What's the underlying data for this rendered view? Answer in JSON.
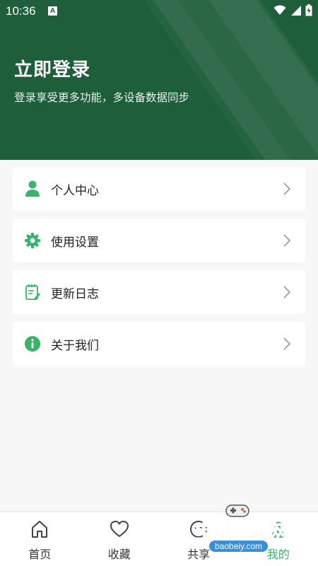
{
  "status_bar": {
    "time": "10:36",
    "notification_badge": "A"
  },
  "header": {
    "title": "立即登录",
    "subtitle": "登录享受更多功能，多设备数据同步",
    "background": "#1e5e3a"
  },
  "menu": {
    "items": [
      {
        "label": "个人中心",
        "icon": "person-icon"
      },
      {
        "label": "使用设置",
        "icon": "gear-icon"
      },
      {
        "label": "更新日志",
        "icon": "log-icon"
      },
      {
        "label": "关于我们",
        "icon": "info-icon"
      }
    ]
  },
  "bottom_nav": {
    "items": [
      {
        "label": "首页",
        "icon": "home-icon",
        "active": false
      },
      {
        "label": "收藏",
        "icon": "heart-icon",
        "active": false
      },
      {
        "label": "共享",
        "icon": "share-icon",
        "active": false
      },
      {
        "label": "我的",
        "icon": "profile-icon",
        "active": true
      }
    ]
  },
  "watermark": {
    "text": "宝贝游戏网",
    "url": "baobeiy.com"
  },
  "colors": {
    "accent": "#3bb36b",
    "header": "#1e5e3a",
    "background": "#f7f7f7"
  }
}
